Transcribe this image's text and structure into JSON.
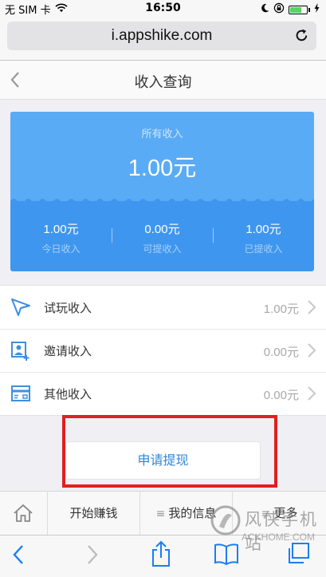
{
  "status_bar": {
    "carrier": "无 SIM 卡",
    "time": "16:50",
    "battery_level": 0.7
  },
  "browser": {
    "url": "i.appshike.com",
    "reload_icon": "reload-icon"
  },
  "header": {
    "title": "收入查询",
    "back_icon": "chevron-left-icon"
  },
  "income_card": {
    "total_label": "所有收入",
    "total_value": "1.00元",
    "stats": [
      {
        "value": "1.00元",
        "label": "今日收入"
      },
      {
        "value": "0.00元",
        "label": "可提收入"
      },
      {
        "value": "1.00元",
        "label": "已提收入"
      }
    ]
  },
  "income_list": [
    {
      "label": "试玩收入",
      "value": "1.00元",
      "icon": "paper-plane-icon"
    },
    {
      "label": "邀请收入",
      "value": "0.00元",
      "icon": "invite-user-icon"
    },
    {
      "label": "其他收入",
      "value": "0.00元",
      "icon": "card-icon"
    }
  ],
  "withdraw": {
    "label": "申请提现"
  },
  "bottom_nav": {
    "home_icon": "home-icon",
    "items": [
      "开始赚钱",
      "我的信息",
      "更多"
    ],
    "menu_glyph": "≡"
  },
  "watermark": {
    "text": "风侠手机站",
    "sub": "ACKHOME.COM"
  },
  "colors": {
    "accent": "#2d86d8",
    "card_top": "#5aabf5",
    "card_bottom": "#3f96ef",
    "highlight": "#e02020"
  }
}
